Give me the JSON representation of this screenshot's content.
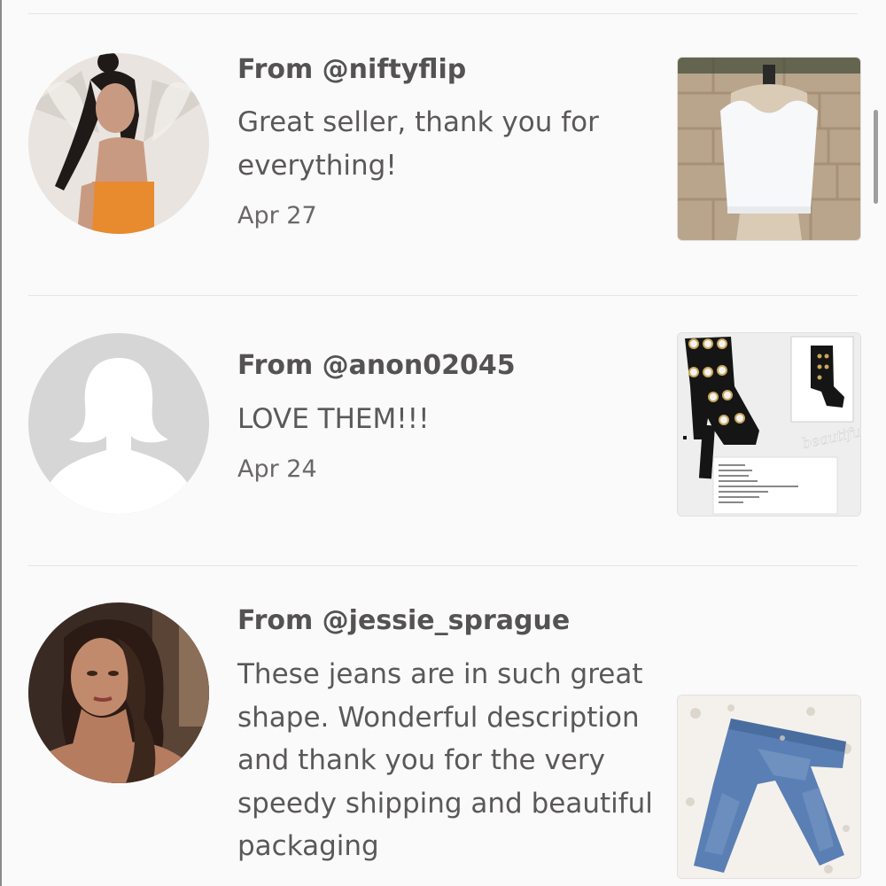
{
  "reviews": [
    {
      "from": "From @niftyflip",
      "comment": "Great seller, thank you for everything!",
      "date": "Apr 27",
      "avatar_icon": "profile-photo",
      "item_icon": "white-crop-top-photo"
    },
    {
      "from": "From @anon02045",
      "comment": "LOVE THEM!!!",
      "date": "Apr 24",
      "avatar_icon": "default-avatar-silhouette",
      "item_icon": "black-heeled-sandals-photo",
      "item_watermark": "beautiful"
    },
    {
      "from": "From @jessie_sprague",
      "comment": "These jeans are in such great shape. Wonderful description and thank you for the very speedy shipping and beautiful packaging",
      "date": "",
      "avatar_icon": "profile-photo",
      "item_icon": "blue-jeans-photo"
    }
  ],
  "colors": {
    "background": "#fbfafa",
    "text_heading": "#545252",
    "text_body": "#5a5858",
    "divider": "#e6e3e3"
  }
}
